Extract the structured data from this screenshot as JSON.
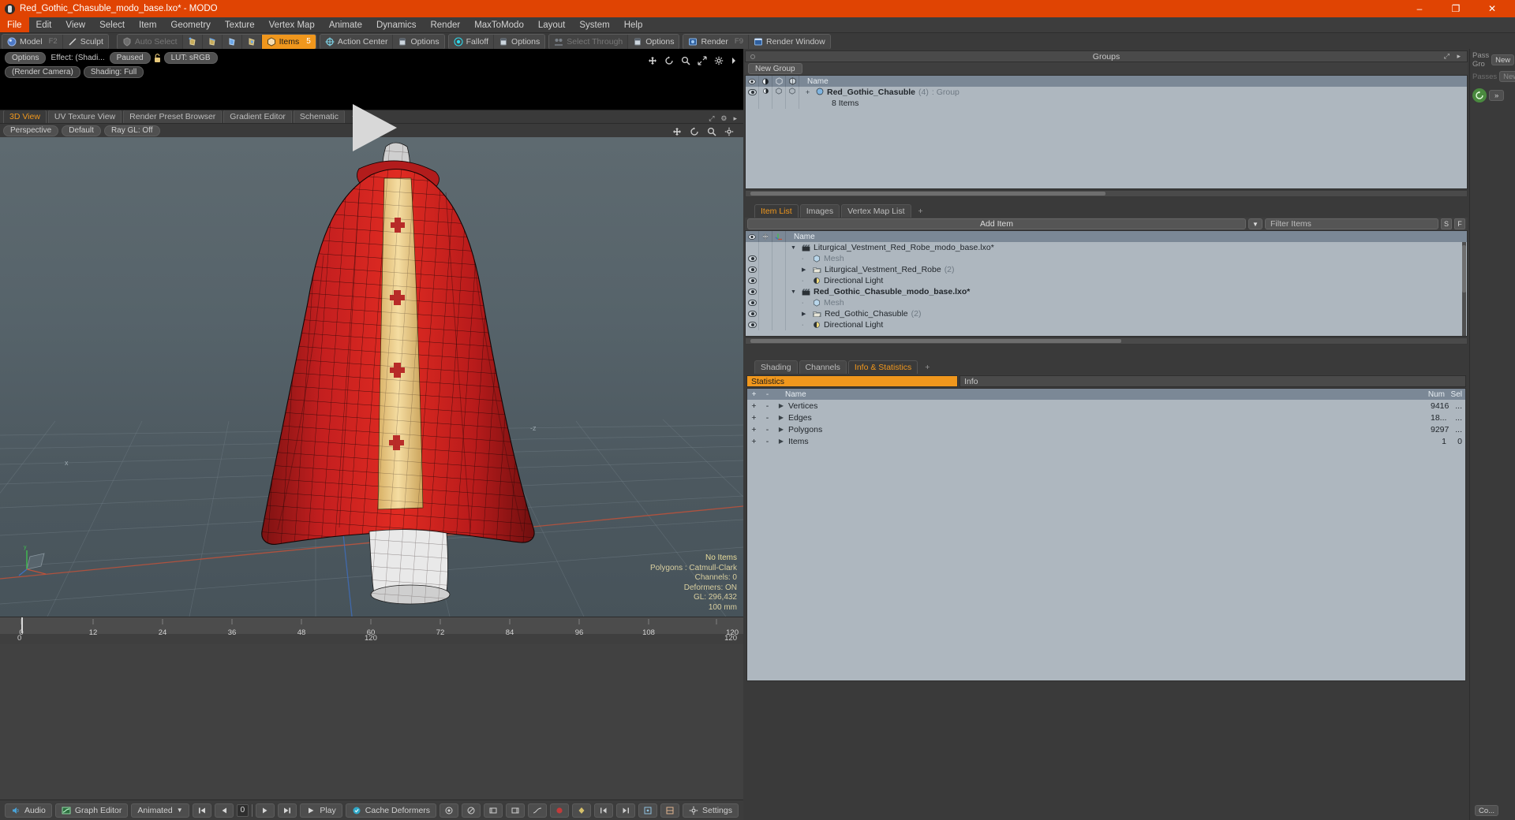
{
  "window": {
    "title": "Red_Gothic_Chasuble_modo_base.lxo* - MODO",
    "logo_icon": "modo-logo-icon",
    "minimize_label": "–",
    "maximize_label": "❐",
    "close_label": "✕",
    "accent_color": "#e04403"
  },
  "menubar": {
    "items": [
      {
        "label": "File",
        "active": true
      },
      {
        "label": "Edit",
        "active": false
      },
      {
        "label": "View",
        "active": false
      },
      {
        "label": "Select",
        "active": false
      },
      {
        "label": "Item",
        "active": false
      },
      {
        "label": "Geometry",
        "active": false
      },
      {
        "label": "Texture",
        "active": false
      },
      {
        "label": "Vertex Map",
        "active": false
      },
      {
        "label": "Animate",
        "active": false
      },
      {
        "label": "Dynamics",
        "active": false
      },
      {
        "label": "Render",
        "active": false
      },
      {
        "label": "MaxToModo",
        "active": false
      },
      {
        "label": "Layout",
        "active": false
      },
      {
        "label": "System",
        "active": false
      },
      {
        "label": "Help",
        "active": false
      }
    ]
  },
  "toolbar": {
    "mode_group": [
      {
        "label": "Model",
        "icon": "sphere-icon",
        "key": "F2",
        "state": "normal"
      },
      {
        "label": "Sculpt",
        "icon": "slash-icon",
        "key": "",
        "state": "normal"
      }
    ],
    "select_group": [
      {
        "label": "Auto Select",
        "icon": "shield-icon",
        "state": "dim"
      },
      {
        "label": "",
        "icon": "vertex-select-icon",
        "state": "normal"
      },
      {
        "label": "",
        "icon": "edge-select-icon",
        "state": "normal"
      },
      {
        "label": "",
        "icon": "polygon-select-icon",
        "state": "normal"
      },
      {
        "label": "",
        "icon": "material-select-icon",
        "state": "normal"
      },
      {
        "label": "Items",
        "icon": "items-icon",
        "state": "on",
        "badge": "5"
      }
    ],
    "action_center": {
      "label": "Action Center",
      "icon": "target-icon"
    },
    "action_options": {
      "label": "Options",
      "icon": "panel-icon"
    },
    "falloff": {
      "label": "Falloff",
      "icon": "falloff-icon"
    },
    "falloff_options": {
      "label": "Options",
      "icon": "panel-icon"
    },
    "select_through": {
      "label": "Select Through",
      "icon": "through-icon",
      "state": "dim"
    },
    "select_options": {
      "label": "Options",
      "icon": "panel-icon"
    },
    "render": {
      "label": "Render",
      "icon": "render-icon",
      "key": "F9"
    },
    "render_window": {
      "label": "Render Window",
      "icon": "render-window-icon"
    }
  },
  "preview": {
    "options_label": "Options",
    "effect_label": "Effect: (Shadi...",
    "paused_label": "Paused",
    "lock_icon": "lock-icon",
    "lut_label": "LUT: sRGB",
    "render_camera_label": "(Render Camera)",
    "shading_label": "Shading: Full",
    "play_icon": "play-triangle-icon",
    "icons": [
      "move-icon",
      "rotate-icon",
      "zoom-icon",
      "fit-icon",
      "gear-icon",
      "caret-right-icon"
    ]
  },
  "viewport_tabs": {
    "tabs": [
      {
        "label": "3D View",
        "active": true
      },
      {
        "label": "UV Texture View",
        "active": false
      },
      {
        "label": "Render Preset Browser",
        "active": false
      },
      {
        "label": "Gradient Editor",
        "active": false
      },
      {
        "label": "Schematic",
        "active": false
      },
      {
        "label": "+",
        "active": false
      }
    ],
    "right_icons": [
      "expand-icon",
      "gear-icon",
      "caret-right-icon"
    ]
  },
  "viewport_header": {
    "perspective_label": "Perspective",
    "shading_label": "Default",
    "raygl_label": "Ray GL: Off",
    "right_icons": [
      "move-icon",
      "rotate-icon",
      "zoom-icon",
      "gear-icon"
    ]
  },
  "viewport": {
    "stats": [
      "No Items",
      "Polygons : Catmull-Clark",
      "Channels: 0",
      "Deformers: ON",
      "GL: 296,432",
      "100 mm"
    ],
    "axis_labels": {
      "x": "x",
      "y": "y",
      "z": "-z",
      "z2": "z"
    }
  },
  "timeline": {
    "top_ticks": [
      "0",
      "12",
      "24",
      "36",
      "48",
      "60",
      "72",
      "84",
      "96",
      "108",
      "120"
    ],
    "end_label": "120",
    "bottom_start": "0",
    "bottom_mid": "120",
    "bottom_end": "120"
  },
  "bottombar": {
    "audio_label": "Audio",
    "audio_icon": "speaker-icon",
    "graph_editor_label": "Graph Editor",
    "graph_editor_icon": "graph-icon",
    "animated_label": "Animated",
    "animated_caret": "▼",
    "frame_value": "0",
    "play_label": "Play",
    "play_icon": "play-icon",
    "cache_deformers_label": "Cache Deformers",
    "cache_icon": "cache-icon",
    "settings_label": "Settings",
    "settings_icon": "gear-icon",
    "transport_icons": [
      "skip-start-icon",
      "step-back-icon",
      "step-forward-icon",
      "skip-end-icon"
    ],
    "extra_icons": [
      "key-icon",
      "circle-slash-icon",
      "range-start-icon",
      "range-end-icon",
      "curve-icon",
      "record-icon",
      "key-set-icon",
      "key-prev-icon",
      "key-next-icon",
      "snap-icon",
      "snap-alt-icon"
    ],
    "command_label": "Co..."
  },
  "groups_panel": {
    "title": "Groups",
    "new_group_label": "New Group",
    "columns": [
      "eye-col-icon",
      "shade-col-icon",
      "wire-col-icon",
      "cage-col-icon",
      "Name"
    ],
    "rows": [
      {
        "expand": "+",
        "icon": "group-icon",
        "name": "Red_Gothic_Chasuble",
        "count": "(4)",
        "suffix": ": Group",
        "bold": true
      },
      {
        "expand": "",
        "icon": "",
        "name": "8 Items",
        "count": "",
        "suffix": "",
        "bold": false
      }
    ]
  },
  "items_panel": {
    "tabs": [
      {
        "label": "Item List",
        "active": true
      },
      {
        "label": "Images",
        "active": false
      },
      {
        "label": "Vertex Map List",
        "active": false
      },
      {
        "label": "+",
        "active": false
      }
    ],
    "add_item_label": "Add Item",
    "add_item_caret": "▼",
    "filter_placeholder": "Filter Items",
    "filter_value": "",
    "btn_s_label": "S",
    "btn_f_label": "F",
    "columns": [
      "eye-col-icon",
      "move-col-icon",
      "axis-col-icon",
      "Name"
    ],
    "rows": [
      {
        "indent": 0,
        "expand": "▼",
        "icon": "scene-icon",
        "name": "Liturgical_Vestment_Red_Robe_modo_base.lxo*",
        "count": "",
        "bold": false,
        "eye": false,
        "dim": false
      },
      {
        "indent": 1,
        "expand": "",
        "icon": "mesh-icon",
        "name": "Mesh",
        "count": "",
        "bold": false,
        "eye": true,
        "dim": true
      },
      {
        "indent": 1,
        "expand": "▶",
        "icon": "folder-icon",
        "name": "Liturgical_Vestment_Red_Robe",
        "count": "(2)",
        "bold": false,
        "eye": true,
        "dim": false
      },
      {
        "indent": 1,
        "expand": "",
        "icon": "light-icon",
        "name": "Directional Light",
        "count": "",
        "bold": false,
        "eye": true,
        "dim": false
      },
      {
        "indent": 0,
        "expand": "▼",
        "icon": "scene-icon",
        "name": "Red_Gothic_Chasuble_modo_base.lxo*",
        "count": "",
        "bold": true,
        "eye": true,
        "dim": false
      },
      {
        "indent": 1,
        "expand": "",
        "icon": "mesh-icon",
        "name": "Mesh",
        "count": "",
        "bold": false,
        "eye": true,
        "dim": true
      },
      {
        "indent": 1,
        "expand": "▶",
        "icon": "folder-icon",
        "name": "Red_Gothic_Chasuble",
        "count": "(2)",
        "bold": false,
        "eye": true,
        "dim": false
      },
      {
        "indent": 1,
        "expand": "",
        "icon": "light-icon",
        "name": "Directional Light",
        "count": "",
        "bold": false,
        "eye": true,
        "dim": false
      }
    ]
  },
  "info_panel": {
    "tabs": [
      {
        "label": "Shading",
        "active": false
      },
      {
        "label": "Channels",
        "active": false
      },
      {
        "label": "Info & Statistics",
        "active": true
      },
      {
        "label": "+",
        "active": false
      }
    ],
    "statistics_label": "Statistics",
    "info_label": "Info",
    "columns": {
      "plus": "+",
      "minus": "-",
      "name": "Name",
      "num": "Num",
      "sel": "Sel"
    },
    "rows": [
      {
        "plus": "+",
        "minus": "-",
        "name": "Vertices",
        "num": "9416",
        "sel": "..."
      },
      {
        "plus": "+",
        "minus": "-",
        "name": "Edges",
        "num": "18...",
        "sel": "..."
      },
      {
        "plus": "+",
        "minus": "-",
        "name": "Polygons",
        "num": "9297",
        "sel": "..."
      },
      {
        "plus": "+",
        "minus": "-",
        "name": "Items",
        "num": "1",
        "sel": "0"
      }
    ]
  },
  "rail": {
    "pass_group_label": "Pass Gro",
    "pass_group_new": "New",
    "passes_label": "Passes",
    "passes_new": "New",
    "refresh_icon": "refresh-circle-icon",
    "forward_icon": "double-arrow-icon",
    "command_label": "Co..."
  }
}
